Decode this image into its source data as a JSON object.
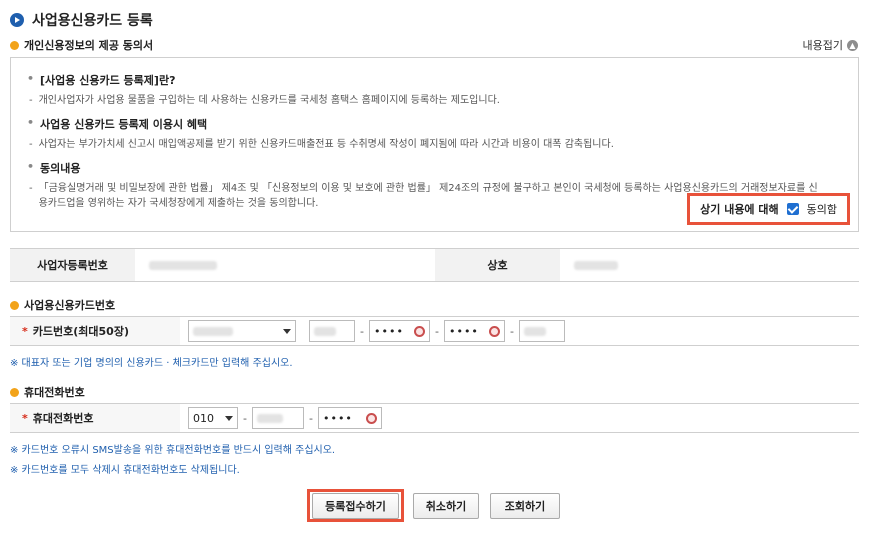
{
  "page": {
    "title": "사업용신용카드 등록"
  },
  "consent_section": {
    "heading": "개인신용정보의 제공 동의서",
    "collapse_label": "내용접기",
    "collapse_icon": "circle-chevron-up-icon",
    "items": [
      {
        "head": "[사업용 신용카드 등록제]란?",
        "body": "개인사업자가 사업용 물품을 구입하는 데 사용하는 신용카드를 국세청 홈택스 홈페이지에 등록하는 제도입니다."
      },
      {
        "head": "사업용 신용카드 등록제 이용시 혜택",
        "body": "사업자는 부가가치세 신고시 매입액공제를 받기 위한 신용카드매출전표 등 수취명세 작성이 폐지됨에 따라 시간과 비용이 대폭 감축됩니다."
      },
      {
        "head": "동의내용",
        "body": "「금융실명거래 및 비밀보장에 관한 법률」 제4조 및 「신용정보의 이용 및 보호에 관한 법률」 제24조의 규정에 불구하고 본인이 국세청에 등록하는 사업용신용카드의 거래정보자료를 신용카드업을 영위하는 자가 국세청장에게 제출하는 것을 동의합니다."
      }
    ],
    "consent_prompt": "상기 내용에 대해",
    "consent_checkbox_label": "동의함",
    "consent_checked": true
  },
  "business_info": {
    "reg_no_label": "사업자등록번호",
    "trade_name_label": "상호"
  },
  "card_section": {
    "heading": "사업용신용카드번호",
    "row_label": "카드번호(최대50장)",
    "masked_1": "••••",
    "masked_2": "••••",
    "dash": "-",
    "note": "※ 대표자 또는 기업 명의의 신용카드 · 체크카드만 입력해 주십시오."
  },
  "phone_section": {
    "heading": "휴대전화번호",
    "row_label": "휴대전화번호",
    "prefix_value": "010",
    "masked": "••••",
    "dash": "-",
    "note_1": "※ 카드번호 오류시 SMS발송을 위한 휴대전화번호를 반드시 입력해 주십시오.",
    "note_2": "※ 카드번호를 모두 삭제시 휴대전화번호도 삭제됩니다."
  },
  "actions": {
    "submit_label": "등록접수하기",
    "cancel_label": "취소하기",
    "inquiry_label": "조회하기"
  },
  "colors": {
    "accent_blue": "#1f5fae",
    "highlight_red": "#e8523a",
    "section_dot": "#f2a31a",
    "required_star": "#d62c1a"
  }
}
